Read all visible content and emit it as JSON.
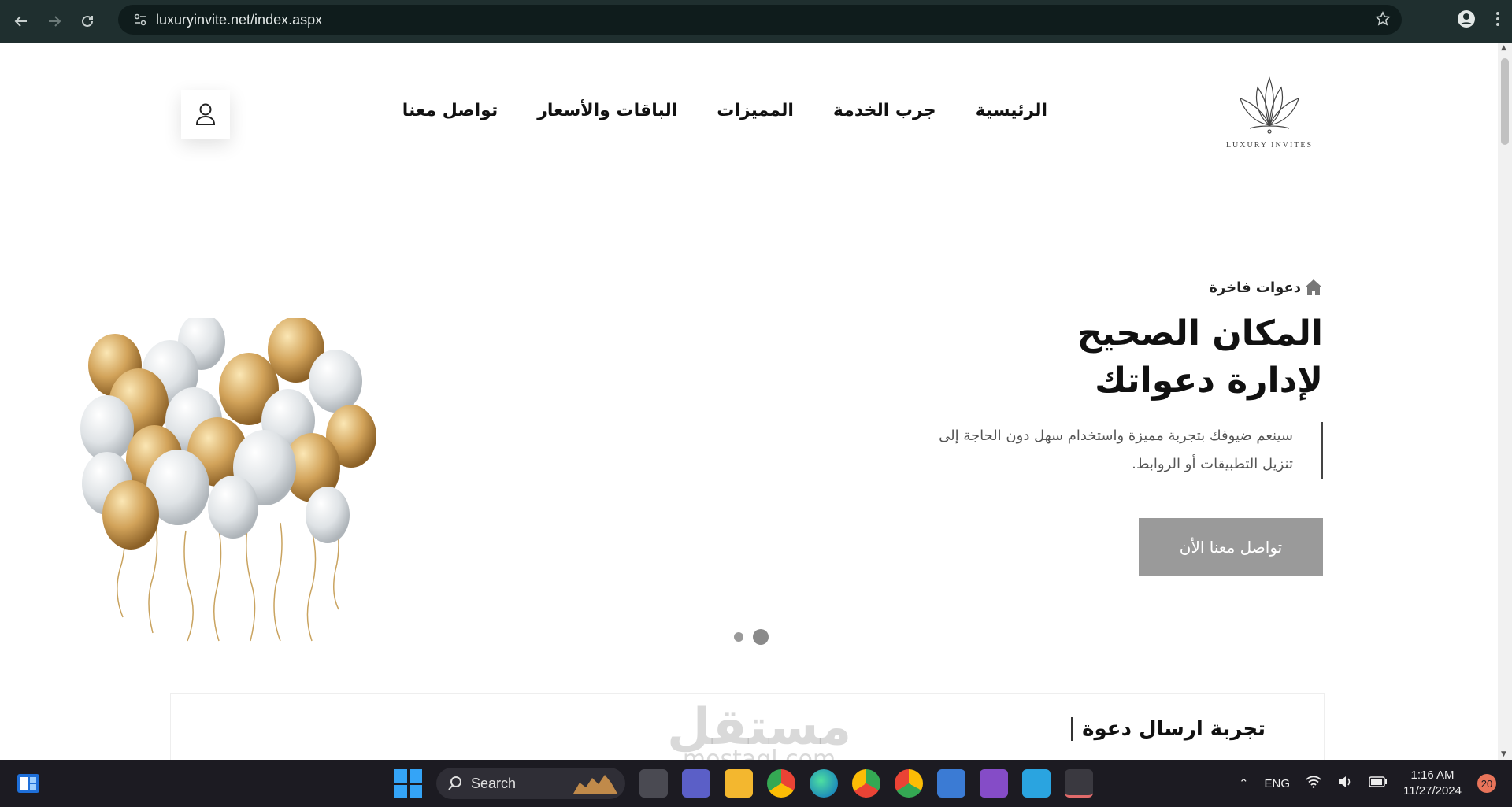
{
  "browser": {
    "url": "luxuryinvite.net/index.aspx"
  },
  "header": {
    "logo_text": "LUXURY INVITES",
    "menu": [
      {
        "label": "الرئيسية"
      },
      {
        "label": "جرب الخدمة"
      },
      {
        "label": "المميزات"
      },
      {
        "label": "الباقات والأسعار"
      },
      {
        "label": "تواصل معنا"
      }
    ]
  },
  "hero": {
    "eyebrow": "دعوات فاخرة",
    "title_line1": "المكان الصحيح",
    "title_line2": "لإدارة دعواتك",
    "desc_line1": "سينعم ضيوفك بتجربة مميزة واستخدام سهل دون الحاجة إلى",
    "desc_line2": "تنزيل التطبيقات أو الروابط.",
    "cta": "تواصل معنا الأن",
    "slides": 2,
    "active_slide": 2
  },
  "section": {
    "title": "تجربة ارسال دعوة"
  },
  "watermark": {
    "ar": "مستقل",
    "en": "mostaql.com"
  },
  "taskbar": {
    "search_placeholder": "Search",
    "language": "ENG",
    "time": "1:16 AM",
    "date": "11/27/2024",
    "notifications": "20"
  },
  "colors": {
    "chrome_bg": "#1f2f2f",
    "cta_bg": "#9a9a9a",
    "taskbar_bg": "#1c1b22",
    "accent_blue": "#34a4f7"
  }
}
